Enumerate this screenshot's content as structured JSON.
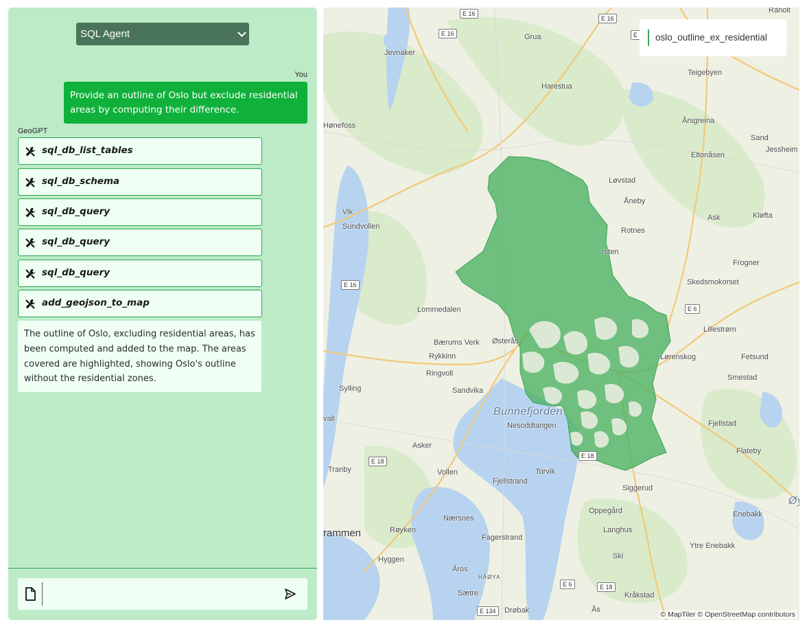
{
  "chat": {
    "agent_selector": {
      "value": "SQL Agent"
    },
    "user_label": "You",
    "user_message": "Provide an outline of Oslo but exclude residential areas by computing their difference.",
    "bot_label": "GeoGPT",
    "tool_calls": [
      {
        "name": "sql_db_list_tables"
      },
      {
        "name": "sql_db_schema"
      },
      {
        "name": "sql_db_query"
      },
      {
        "name": "sql_db_query"
      },
      {
        "name": "sql_db_query"
      },
      {
        "name": "add_geojson_to_map"
      }
    ],
    "bot_reply": "The outline of Oslo, excluding residential areas, has been computed and added to the map. The areas covered are highlighted, showing Oslo's outline without the residential zones.",
    "input": {
      "value": "",
      "placeholder": ""
    }
  },
  "map": {
    "layer_legend": {
      "name": "oslo_outline_ex_residential",
      "color": "#3aa356"
    },
    "attribution": "© MapTiler © OpenStreetMap contributors",
    "places": [
      "Råholt",
      "Grua",
      "Jevnaker",
      "Harestua",
      "Teigebyen",
      "Hønefoss",
      "Årsgreina",
      "Sand",
      "Jessheim",
      "Eltonåsen",
      "Løvstad",
      "Åneby",
      "Vik",
      "Sundvollen",
      "Rotnes",
      "Ask",
      "Kløfta",
      "Frogner",
      "Skedsmokorset",
      "Lommedalen",
      "Lillestrøm",
      "Bærums Verk",
      "Østerås",
      "Rykkinn",
      "Lørenskog",
      "Fetsund",
      "Ringvoll",
      "Smestad",
      "Sylling",
      "Sandvika",
      "Bunnefjorden",
      "Nesoddtangen",
      "Fjellstad",
      "Asker",
      "Flateby",
      "Tranby",
      "Vollen",
      "Torvik",
      "Fjellstrand",
      "Siggerud",
      "Enebakk",
      "Nærsnes",
      "Oppegård",
      "rammen",
      "Røyken",
      "Langhus",
      "Fagerstrand",
      "Hyggen",
      "Ski",
      "Ytre Enebakk",
      "Åros",
      "HÅØYA",
      "Sætre",
      "Kråkstad",
      "Drøbak",
      "Ås",
      "Øy",
      "vall",
      "rsten"
    ],
    "roads": [
      "E 16",
      "E 16",
      "E 16",
      "E 16",
      "E 16",
      "E 6",
      "E 6",
      "E 18",
      "E 18",
      "E 18",
      "E 134"
    ],
    "colors": {
      "water": "#b7d3f0",
      "land": "#eef0e3",
      "forest": "#d7e9c9",
      "road": "#f5c97a",
      "polygon": "#4fb364"
    }
  }
}
